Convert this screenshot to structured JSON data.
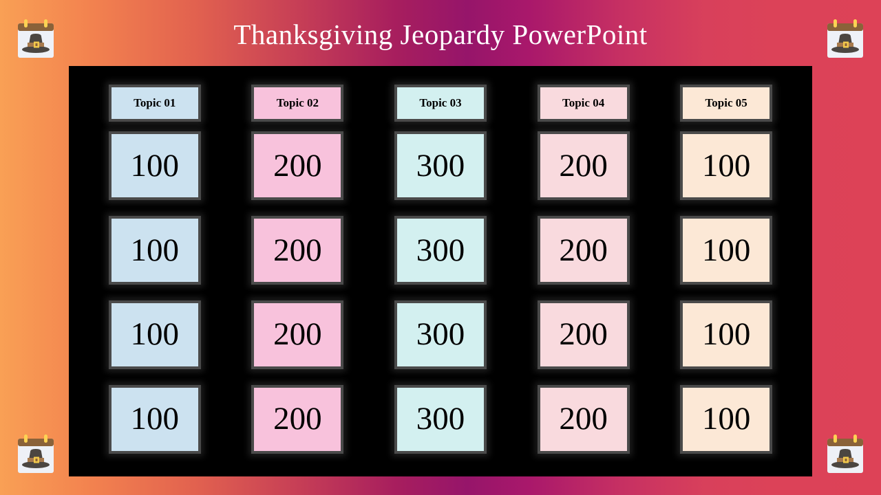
{
  "slide": {
    "title": "Thanksgiving Jeopardy PowerPoint",
    "title_color": "#ffffff",
    "background_colors": [
      "#f9a055",
      "#96156a",
      "#dd4257"
    ],
    "board_background": "#000000"
  },
  "decorations": {
    "icon_name": "pilgrim-hat-calendar-icon",
    "calendar_body_color": "#eef1f7",
    "calendar_top_bar_color": "#8a6239",
    "calendar_ring_color": "#fcd253",
    "hat_color": "#4b4641",
    "hat_band_color": "#a87a4c",
    "hat_buckle_color": "#f2c94c",
    "positions": [
      "top-left",
      "top-right",
      "bottom-left",
      "bottom-right"
    ]
  },
  "board": {
    "categories": [
      {
        "label": "Topic 01",
        "color": "#cce2f0"
      },
      {
        "label": "Topic 02",
        "color": "#f8c2dc"
      },
      {
        "label": "Topic 03",
        "color": "#d3f0f0"
      },
      {
        "label": "Topic 04",
        "color": "#f9dade"
      },
      {
        "label": "Topic 05",
        "color": "#fce8d6"
      }
    ],
    "rows": [
      [
        {
          "value": "100",
          "color": "#cce2f0"
        },
        {
          "value": "200",
          "color": "#f8c2dc"
        },
        {
          "value": "300",
          "color": "#d3f0f0"
        },
        {
          "value": "200",
          "color": "#f9dade"
        },
        {
          "value": "100",
          "color": "#fce8d6"
        }
      ],
      [
        {
          "value": "100",
          "color": "#cce2f0"
        },
        {
          "value": "200",
          "color": "#f8c2dc"
        },
        {
          "value": "300",
          "color": "#d3f0f0"
        },
        {
          "value": "200",
          "color": "#f9dade"
        },
        {
          "value": "100",
          "color": "#fce8d6"
        }
      ],
      [
        {
          "value": "100",
          "color": "#cce2f0"
        },
        {
          "value": "200",
          "color": "#f8c2dc"
        },
        {
          "value": "300",
          "color": "#d3f0f0"
        },
        {
          "value": "200",
          "color": "#f9dade"
        },
        {
          "value": "100",
          "color": "#fce8d6"
        }
      ],
      [
        {
          "value": "100",
          "color": "#cce2f0"
        },
        {
          "value": "200",
          "color": "#f8c2dc"
        },
        {
          "value": "300",
          "color": "#d3f0f0"
        },
        {
          "value": "200",
          "color": "#f9dade"
        },
        {
          "value": "100",
          "color": "#fce8d6"
        }
      ]
    ]
  }
}
